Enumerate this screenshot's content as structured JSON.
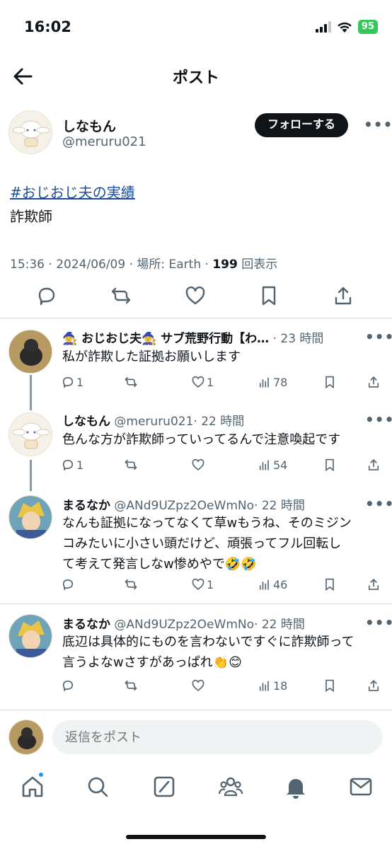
{
  "status": {
    "time": "16:02",
    "battery": "95"
  },
  "header": {
    "title": "ポスト"
  },
  "post": {
    "author_name": "しなもん",
    "author_handle": "@meruru021",
    "follow_label": "フォローする",
    "more": "•••",
    "hashtag": "#おじおじ夫の実績",
    "text": "詐欺師",
    "meta_time": "15:36 · 2024/06/09 · 場所: Earth · ",
    "meta_views": "199",
    "meta_views_label": " 回表示"
  },
  "replies": [
    {
      "name": "🧙 おじおじ夫🧙 サブ荒野行動【わ…",
      "handle": "",
      "time": "· 23 時間",
      "lines": [
        "私が詐欺した証拠お願いします"
      ],
      "replies": "1",
      "retweets": "",
      "likes": "1",
      "views": "78"
    },
    {
      "name": "しなもん",
      "handle": "@meruru021",
      "time": "· 22 時間",
      "lines": [
        "色んな方が詐欺師っていってるんで注意喚起です"
      ],
      "replies": "1",
      "retweets": "",
      "likes": "",
      "views": "54"
    },
    {
      "name": "まるなか",
      "handle": "@ANd9UZpz2OeWmNo",
      "time": "· 22 時間",
      "lines": [
        "なんも証拠になってなくて草wもうね、そのミジン",
        "コみたいに小さい頭だけど、頑張ってフル回転し",
        "て考えて発言しなw惨めやで🤣🤣"
      ],
      "replies": "",
      "retweets": "",
      "likes": "1",
      "views": "46"
    },
    {
      "name": "まるなか",
      "handle": "@ANd9UZpz2OeWmNo",
      "time": "· 22 時間",
      "lines": [
        "底辺は具体的にものを言わないですぐに詐欺師って",
        "言うよなwさすがあっぱれ👏😊"
      ],
      "replies": "",
      "retweets": "",
      "likes": "",
      "views": "18"
    }
  ],
  "reply_box": {
    "placeholder": "返信をポスト"
  },
  "colors": {
    "accent": "#1d9bf0",
    "link": "#1d4d9b",
    "battery": "#34c759",
    "text": "#0f1419",
    "muted": "#536471"
  }
}
